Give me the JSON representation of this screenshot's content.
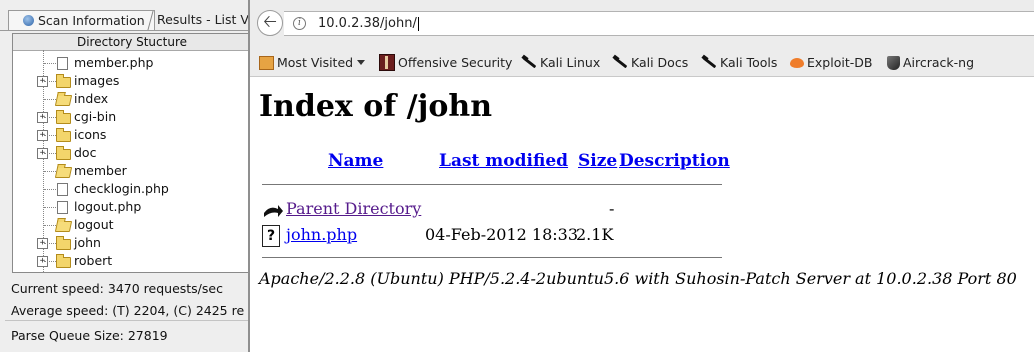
{
  "left_app": {
    "tabs": {
      "scan": "Scan Information",
      "results": "Results - List V"
    },
    "tree": {
      "header": "Directory Stucture",
      "items": [
        {
          "label": "member.php",
          "type": "file",
          "expand": ""
        },
        {
          "label": "images",
          "type": "folder",
          "expand": "+"
        },
        {
          "label": "index",
          "type": "folder-open",
          "expand": ""
        },
        {
          "label": "cgi-bin",
          "type": "folder",
          "expand": "+"
        },
        {
          "label": "icons",
          "type": "folder",
          "expand": "+"
        },
        {
          "label": "doc",
          "type": "folder",
          "expand": "+"
        },
        {
          "label": "member",
          "type": "folder-open",
          "expand": ""
        },
        {
          "label": "checklogin.php",
          "type": "file",
          "expand": ""
        },
        {
          "label": "logout.php",
          "type": "file",
          "expand": ""
        },
        {
          "label": "logout",
          "type": "folder-open",
          "expand": ""
        },
        {
          "label": "john",
          "type": "folder",
          "expand": "+"
        },
        {
          "label": "robert",
          "type": "folder",
          "expand": "+"
        }
      ]
    },
    "stats": {
      "current_speed": "Current speed: 3470 requests/sec",
      "average_speed": "Average speed: (T) 2204, (C) 2425 re",
      "parse_queue": "Parse Queue Size: 27819"
    }
  },
  "browser": {
    "url": "10.0.2.38/john/",
    "bookmarks": [
      {
        "label": "Most Visited",
        "icon": "most-visited-icon"
      },
      {
        "label": "Offensive Security",
        "icon": "offsec-icon"
      },
      {
        "label": "Kali Linux",
        "icon": "kali-dragon-icon"
      },
      {
        "label": "Kali Docs",
        "icon": "kali-dragon-icon"
      },
      {
        "label": "Kali Tools",
        "icon": "kali-dragon-icon"
      },
      {
        "label": "Exploit-DB",
        "icon": "exploitdb-icon"
      },
      {
        "label": "Aircrack-ng",
        "icon": "aircrack-icon"
      }
    ]
  },
  "page": {
    "title": "Index of /john",
    "columns": {
      "name": "Name",
      "modified": "Last modified",
      "size": "Size",
      "description": "Description"
    },
    "rows": [
      {
        "name": "Parent Directory",
        "modified": "",
        "size": "-",
        "description": ""
      },
      {
        "name": "john.php",
        "modified": "04-Feb-2012 18:33",
        "size": "2.1K",
        "description": ""
      }
    ],
    "footer": "Apache/2.2.8 (Ubuntu) PHP/5.2.4-2ubuntu5.6 with Suhosin-Patch Server at 10.0.2.38 Port 80"
  },
  "colors": {
    "link": "#0000ee",
    "visited": "#551a8b",
    "folder": "#f3d56b"
  }
}
